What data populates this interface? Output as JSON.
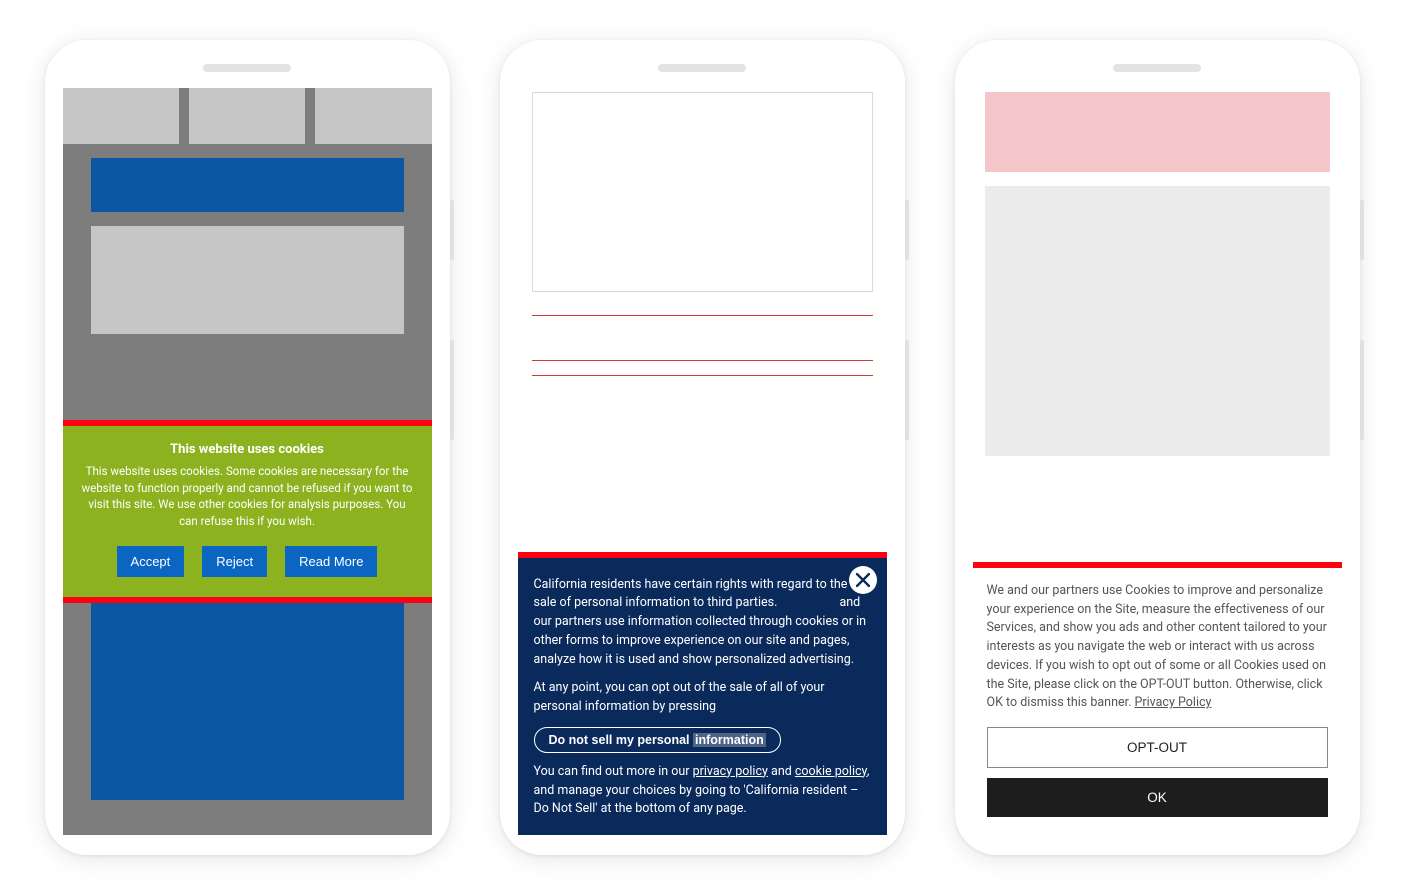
{
  "phone1": {
    "banner": {
      "title": "This website uses cookies",
      "text": "This website uses cookies. Some cookies are necessary for the website to function properly and cannot be refused if you want to visit this site. We use other cookies for analysis purposes. You can refuse this if you wish.",
      "accept_label": "Accept",
      "reject_label": "Reject",
      "readmore_label": "Read More"
    }
  },
  "phone2": {
    "banner": {
      "p1_a": "California residents have certain rights with regard to the sale of personal information to third parties.",
      "p1_b": "and our partners use information collected through cookies or in other forms to improve experience on our site and pages, analyze how it is used and show personalized advertising.",
      "p2": "At any point, you can opt out of the sale of all of your personal information by pressing",
      "btn_a": "Do not sell my personal ",
      "btn_b": "information",
      "p3_a": "You can find out more in our ",
      "link_privacy": "privacy policy",
      "p3_b": " and ",
      "link_cookie": "cookie policy",
      "p3_c": ", and manage your choices by going to 'California resident – Do Not Sell' at the bottom of any page."
    }
  },
  "phone3": {
    "banner": {
      "text_a": "We and our partners use Cookies to improve and personalize your experience on the Site, measure the effectiveness of our Services, and show you ads and other content tailored to your interests as you navigate the web or interact with us across devices. If you wish to opt out of some or all Cookies used on the Site, please click on the OPT-OUT button. Otherwise, click OK to dismiss this banner. ",
      "link_privacy": "Privacy Policy",
      "optout_label": "OPT-OUT",
      "ok_label": "OK"
    }
  }
}
